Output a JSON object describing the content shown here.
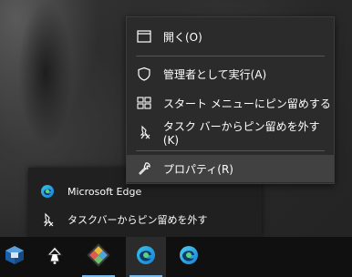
{
  "context_menu": {
    "items": [
      {
        "label": "開く(O)",
        "icon": "window-icon"
      },
      {
        "label": "管理者として実行(A)",
        "icon": "shield-icon"
      },
      {
        "label": "スタート メニューにピン留めする",
        "icon": "start-tiles-icon"
      },
      {
        "label": "タスク バーからピン留めを外す(K)",
        "icon": "unpin-icon"
      },
      {
        "label": "プロパティ(R)",
        "icon": "wrench-icon"
      }
    ]
  },
  "jump_list": {
    "items": [
      {
        "label": "Microsoft Edge",
        "icon": "edge-icon"
      },
      {
        "label": "タスクバーからピン留めを外す",
        "icon": "unpin-icon"
      }
    ]
  },
  "taskbar": {
    "apps": [
      {
        "name": "virtualbox-icon",
        "running": false
      },
      {
        "name": "inkscape-icon",
        "running": false
      },
      {
        "name": "puzzle-app-icon",
        "running": true
      },
      {
        "name": "edge-icon",
        "running": true,
        "active": true
      },
      {
        "name": "edge-dev-icon",
        "running": false
      }
    ]
  },
  "colors": {
    "menu_bg": "#2b2b2b",
    "hover_bg": "#414141",
    "taskbar_bg": "#101010",
    "accent": "#76b9ed"
  }
}
